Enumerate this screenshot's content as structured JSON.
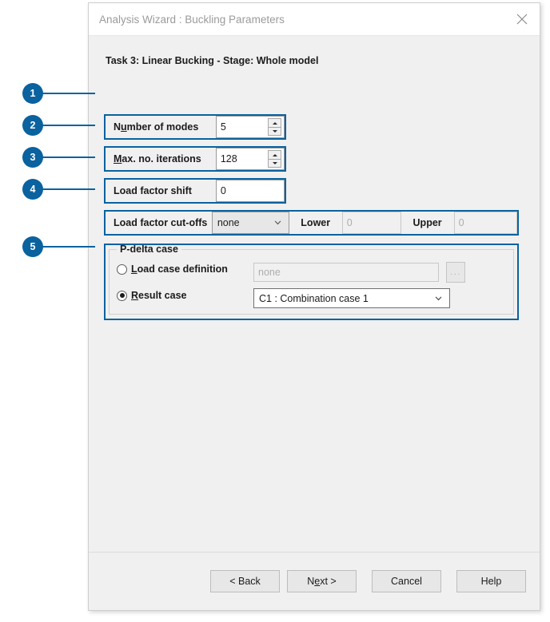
{
  "window": {
    "title": "Analysis Wizard : Buckling Parameters",
    "close_icon": "close-icon"
  },
  "task_line": "Task 3: Linear Bucking  -  Stage: Whole model",
  "fields": {
    "number_of_modes": {
      "label_pre": "N",
      "label_accel": "u",
      "label_post": "mber of modes",
      "value": "5",
      "spinner_up": "spinner-up-icon",
      "spinner_down": "spinner-down-icon"
    },
    "max_iterations": {
      "label_pre": "",
      "label_accel": "M",
      "label_post": "ax. no. iterations",
      "value": "128",
      "spinner_up": "spinner-up-icon",
      "spinner_down": "spinner-down-icon"
    },
    "load_factor_shift": {
      "label": "Load factor shift",
      "value": "0"
    },
    "load_factor_cutoffs": {
      "label": "Load factor cut-offs",
      "selected": "none",
      "options": [
        "none"
      ],
      "lower_label": "Lower",
      "lower_value": "0",
      "lower_enabled": false,
      "upper_label": "Upper",
      "upper_value": "0",
      "upper_enabled": false
    }
  },
  "pdelta_group": {
    "title": "P-delta case",
    "load_case_definition": {
      "label_pre": "",
      "label_accel": "L",
      "label_post": "oad case definition",
      "selected": false,
      "value": "none",
      "enabled": false,
      "browse_label": "...",
      "browse_icon": "ellipsis-icon"
    },
    "result_case": {
      "label_pre": "",
      "label_accel": "R",
      "label_post": "esult case",
      "selected": true,
      "value": "C1 : Combination case 1",
      "options": [
        "C1 : Combination case 1"
      ]
    }
  },
  "footer": {
    "back": "< Back",
    "next_pre": "N",
    "next_accel": "e",
    "next_post": "xt >",
    "cancel": "Cancel",
    "help": "Help"
  },
  "annotations": [
    {
      "number": "1"
    },
    {
      "number": "2"
    },
    {
      "number": "3"
    },
    {
      "number": "4"
    },
    {
      "number": "5"
    }
  ],
  "colors": {
    "accent": "#0a629f",
    "dialog_bg": "#f0f0f0",
    "title_text": "#9b9b9b"
  }
}
